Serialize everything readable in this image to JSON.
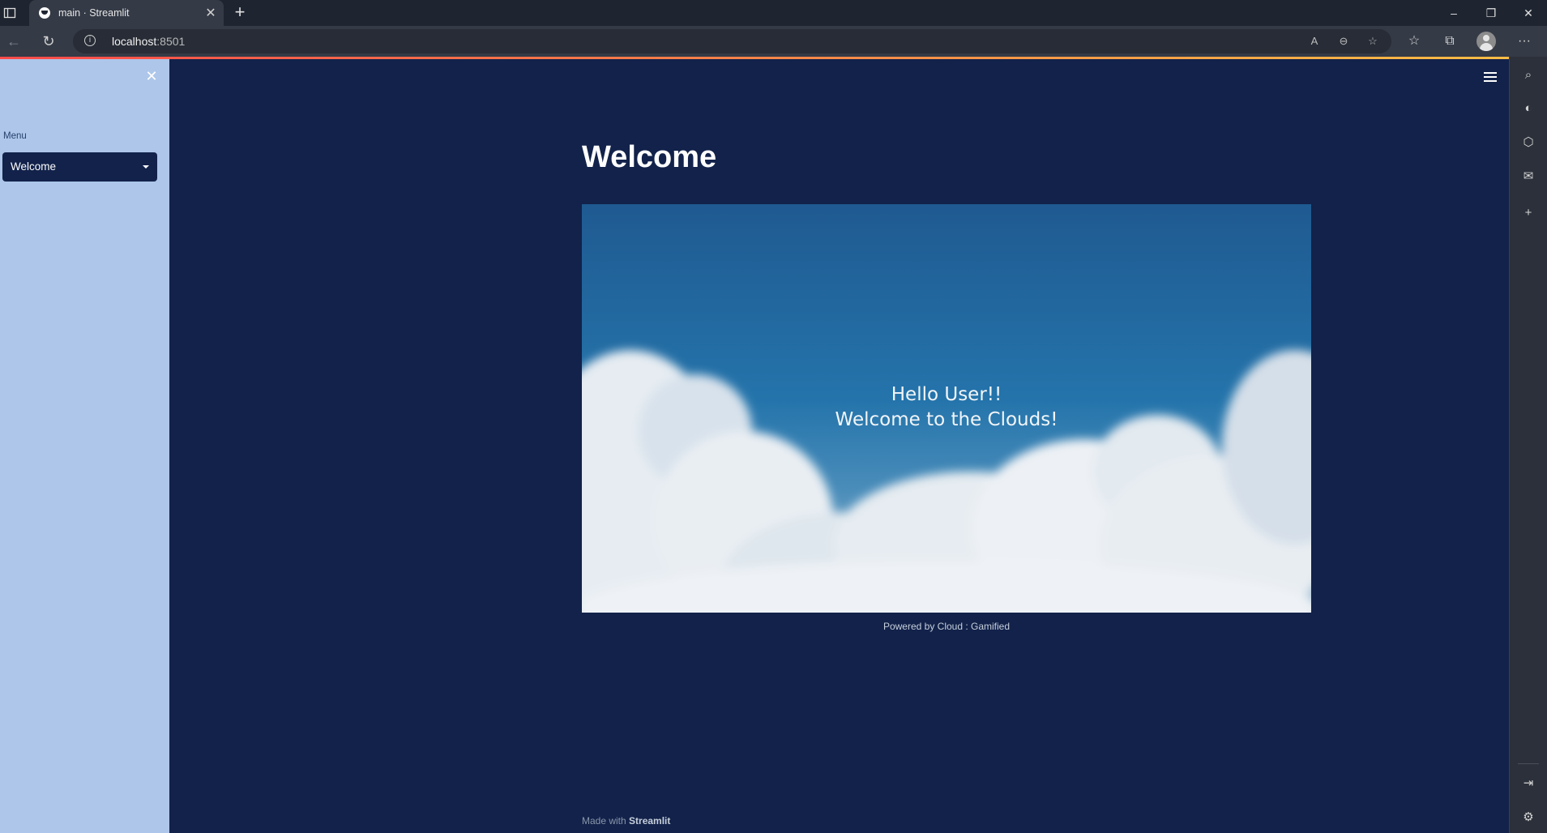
{
  "browser": {
    "tab_title": "main · Streamlit",
    "tab_close_icon": "close-icon",
    "new_tab_symbol": "+",
    "url_host": "localhost",
    "url_port": ":8501",
    "window_controls": {
      "minimize": "–",
      "restore": "❐",
      "close": "✕"
    },
    "menu_symbol": "···"
  },
  "sidebar": {
    "close_symbol": "✕",
    "menu_label": "Menu",
    "select_value": "Welcome"
  },
  "main": {
    "title": "Welcome",
    "hero_line1": "Hello User!!",
    "hero_line2": "Welcome to the Clouds!",
    "caption": "Powered by Cloud : Gamified",
    "footer_prefix": "Made with ",
    "footer_brand": "Streamlit"
  },
  "colors": {
    "background": "#12224a",
    "sidebar": "#adc6ea",
    "text": "#ffffff",
    "decoration_start": "#ff4b4b",
    "decoration_end": "#ffbd45"
  }
}
